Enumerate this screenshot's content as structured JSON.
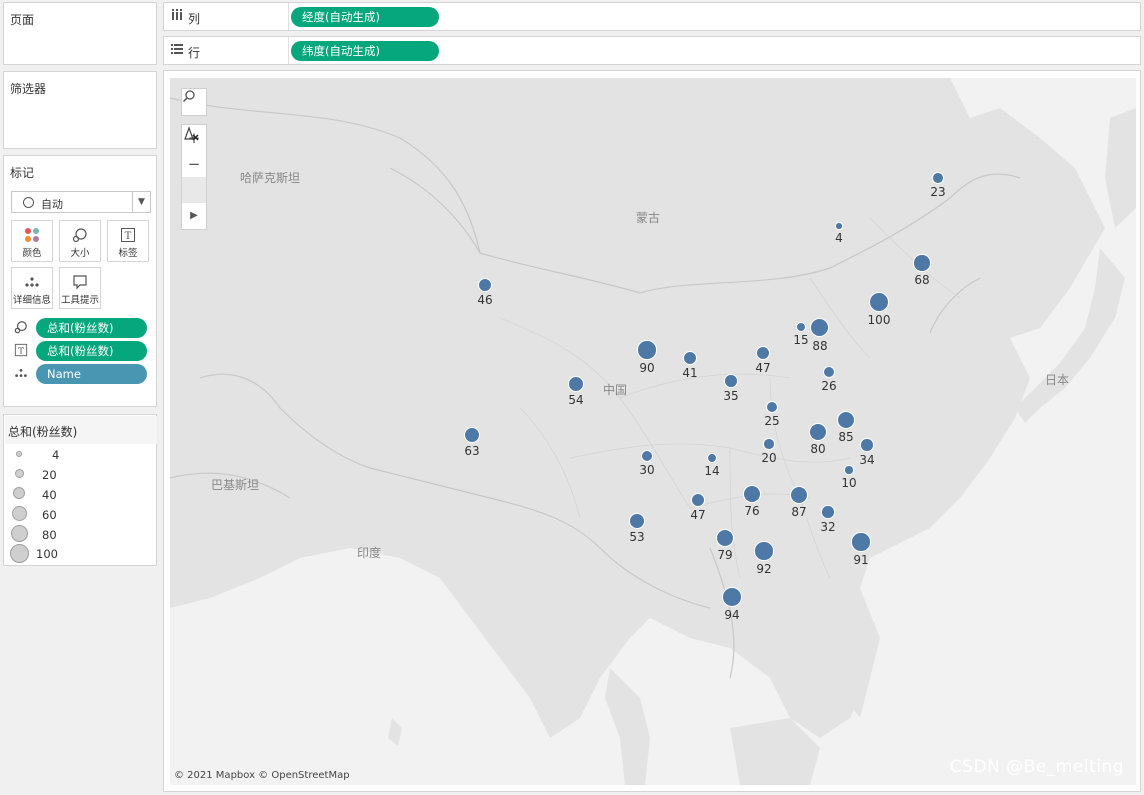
{
  "left": {
    "pages_title": "页面",
    "filters_title": "筛选器",
    "marks_title": "标记",
    "mark_type": "自动",
    "buttons": [
      {
        "label": "颜色",
        "icon": "color-dots-icon"
      },
      {
        "label": "大小",
        "icon": "size-icon"
      },
      {
        "label": "标签",
        "icon": "text-label-icon"
      },
      {
        "label": "详细信息",
        "icon": "detail-dots-icon"
      },
      {
        "label": "工具提示",
        "icon": "tooltip-icon"
      }
    ],
    "mark_fields": [
      {
        "icon": "size-icon",
        "label": "总和(粉丝数)",
        "color": "#06a77d"
      },
      {
        "icon": "text-label-icon",
        "label": "总和(粉丝数)",
        "color": "#06a77d"
      },
      {
        "icon": "detail-dots-icon",
        "label": "Name",
        "color": "#4996b2"
      }
    ],
    "legend": {
      "title": "总和(粉丝数)",
      "items": [
        "4",
        "20",
        "40",
        "60",
        "80",
        "100"
      ]
    }
  },
  "shelves": {
    "columns": {
      "label": "列",
      "icon": "columns-icon",
      "pill": "经度(自动生成)"
    },
    "rows": {
      "label": "行",
      "icon": "rows-icon",
      "pill": "纬度(自动生成)"
    }
  },
  "map": {
    "places": [
      "哈萨克斯坦",
      "蒙古",
      "中国",
      "日本",
      "巴基斯坦",
      "印度"
    ],
    "attribution": "© 2021 Mapbox © OpenStreetMap",
    "watermark": "CSDN @Be_melting",
    "marker_color": "#4e79a7",
    "values": [
      23,
      4,
      68,
      100,
      46,
      15,
      88,
      90,
      41,
      47,
      26,
      54,
      35,
      25,
      85,
      63,
      80,
      34,
      20,
      30,
      14,
      10,
      76,
      87,
      47,
      32,
      53,
      79,
      92,
      91,
      94
    ]
  }
}
